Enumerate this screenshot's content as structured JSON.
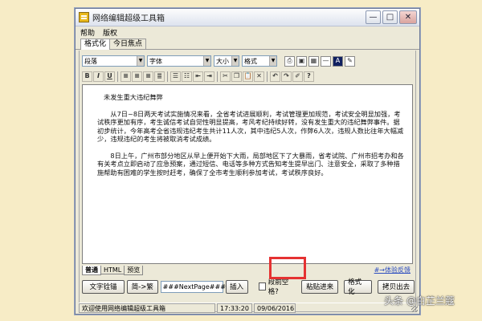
{
  "window": {
    "title": "网络编辑超级工具箱",
    "controls": [
      "—",
      "□",
      "✕"
    ]
  },
  "menu": [
    "帮助",
    "版权"
  ],
  "tabs": [
    "格式化",
    "今日焦点"
  ],
  "toolbar1": {
    "paragraph": "段落",
    "font": "字体",
    "size": "大小",
    "format": "格式"
  },
  "toolbar2": {
    "bold": "B",
    "italic": "I",
    "underline": "U"
  },
  "editor": {
    "title": "未发生重大违纪舞弊",
    "paragraphs": [
      "从7日~8日两天考试实施情况来看，全省考试进展顺利，考试管理更加规范，考试安全明显加强，考试秩序更加有序，考生诚信考试自觉性明显提高，考风考纪持续好转，没有发生重大的违纪舞弊事件。据初步统计，今年高考全省违规违纪考生共计11人次，其中违纪5人次，作弊6人次，违规人数比往年大幅减少，违规违纪的考生将被取消考试成绩。",
      "8日上午，广州市部分地区从早上便开始下大雨，局部地区下了大暴雨，省考试院、广州市招考办和各有关考点立即启动了应急预案，通过短信、电话等多种方式告知考生提早出门、注意安全，采取了多种措施帮助有困难的学生按时赶考，确保了全市考生顺利参加考试，考试秩序良好。"
    ]
  },
  "bottom_tabs": [
    "普通",
    "HTML",
    "预览"
  ],
  "link": "#→体验反馈",
  "buttons": {
    "text_extract": "文字铨锚",
    "simp_trad": "简->繁",
    "insert": "插入",
    "paste": "粘贴进来",
    "format": "格式化",
    "copy_out": "拷贝出去"
  },
  "nextpage_input": "###NextPage###",
  "checkbox_label": "段前空格?",
  "status": {
    "welcome": "欢迎使用网络编辑超级工具箱",
    "time": "17:33:20",
    "date": "09/06/2016"
  },
  "watermark": "头条 @白芷兰蔻"
}
